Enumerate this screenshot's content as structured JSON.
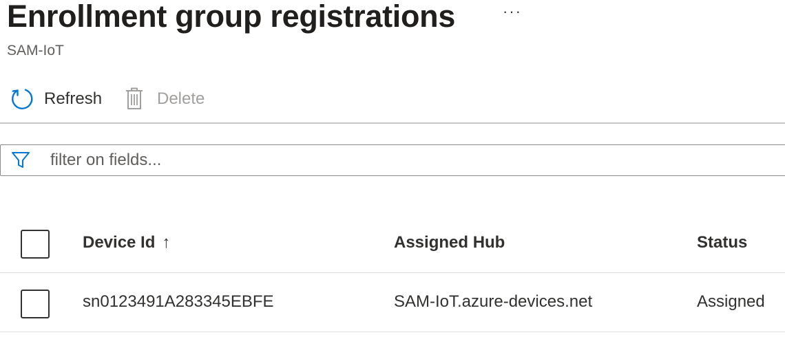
{
  "header": {
    "title": "Enrollment group registrations",
    "more_label": "···",
    "subtitle": "SAM-IoT"
  },
  "toolbar": {
    "refresh_label": "Refresh",
    "refresh_icon": "refresh-icon",
    "delete_label": "Delete",
    "delete_icon": "trash-icon",
    "delete_enabled": false
  },
  "filter": {
    "placeholder": "filter on fields...",
    "value": "",
    "icon": "filter-icon"
  },
  "grid": {
    "columns": {
      "device_id": "Device Id",
      "sort_indicator": "↑",
      "assigned_hub": "Assigned Hub",
      "status": "Status"
    },
    "rows": [
      {
        "device_id": "sn0123491A283345EBFE",
        "assigned_hub": "SAM-IoT.azure-devices.net",
        "status": "Assigned",
        "selected": false
      }
    ]
  },
  "colors": {
    "accent": "#0078d4",
    "text": "#323130",
    "disabled": "#a19f9d",
    "divider": "#c8c6c4"
  }
}
